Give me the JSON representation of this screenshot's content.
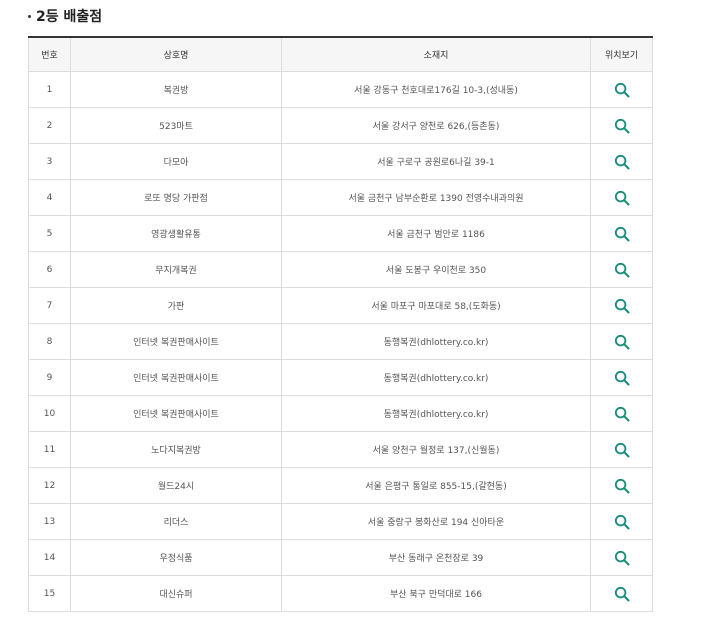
{
  "section": {
    "title": "2등 배출점"
  },
  "table": {
    "headers": [
      "번호",
      "상호명",
      "소재지",
      "위치보기"
    ],
    "rows": [
      {
        "no": "1",
        "name": "복권방",
        "address": "서울 강동구 천호대로176길 10-3,(성내동)"
      },
      {
        "no": "2",
        "name": "523마트",
        "address": "서울 강서구 양천로 626,(등촌동)"
      },
      {
        "no": "3",
        "name": "다모아",
        "address": "서울 구로구 공원로6나길 39-1"
      },
      {
        "no": "4",
        "name": "로또 명당 가판점",
        "address": "서울 금천구 남부순환로 1390 전영수내과의원"
      },
      {
        "no": "5",
        "name": "영광생활유통",
        "address": "서울 금천구 범안로 1186"
      },
      {
        "no": "6",
        "name": "무지개복권",
        "address": "서울 도봉구 우이천로 350"
      },
      {
        "no": "7",
        "name": "가판",
        "address": "서울 마포구 마포대로 58,(도화동)"
      },
      {
        "no": "8",
        "name": "인터넷 복권판매사이트",
        "address": "동행복권(dhlottery.co.kr)"
      },
      {
        "no": "9",
        "name": "인터넷 복권판매사이트",
        "address": "동행복권(dhlottery.co.kr)"
      },
      {
        "no": "10",
        "name": "인터넷 복권판매사이트",
        "address": "동행복권(dhlottery.co.kr)"
      },
      {
        "no": "11",
        "name": "노다지복권방",
        "address": "서울 양천구 월정로 137,(신월동)"
      },
      {
        "no": "12",
        "name": "월드24시",
        "address": "서울 은평구 통일로 855-15,(갈현동)"
      },
      {
        "no": "13",
        "name": "리더스",
        "address": "서울 중랑구 봉화산로 194 신아타운"
      },
      {
        "no": "14",
        "name": "우정식품",
        "address": "부산 동래구 온천장로 39"
      },
      {
        "no": "15",
        "name": "대신슈퍼",
        "address": "부산 북구 만덕대로 166"
      }
    ]
  },
  "icons": {
    "view_location": "search-icon"
  },
  "colors": {
    "accent": "#1a8a7a",
    "header_bg": "#f6f6f6",
    "border": "#dcdcdc"
  }
}
